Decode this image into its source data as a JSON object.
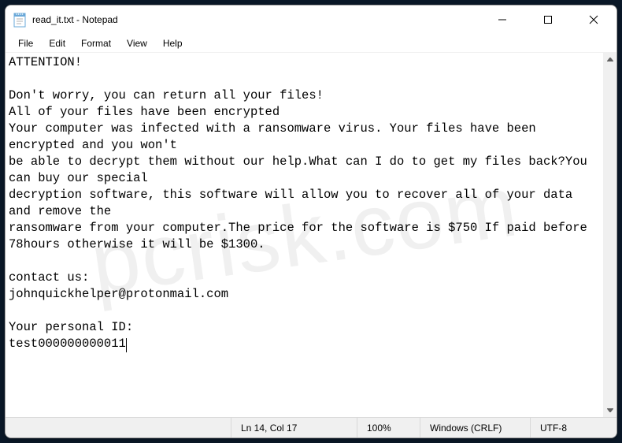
{
  "titlebar": {
    "title": "read_it.txt - Notepad"
  },
  "menubar": {
    "file": "File",
    "edit": "Edit",
    "format": "Format",
    "view": "View",
    "help": "Help"
  },
  "content": {
    "text": "ATTENTION!\n\nDon't worry, you can return all your files!\nAll of your files have been encrypted\nYour computer was infected with a ransomware virus. Your files have been encrypted and you won't\nbe able to decrypt them without our help.What can I do to get my files back?You can buy our special\ndecryption software, this software will allow you to recover all of your data and remove the\nransomware from your computer.The price for the software is $750 If paid before 78hours otherwise it will be $1300.\n\ncontact us:\njohnquickhelper@protonmail.com\n\nYour personal ID:\ntest000000000011"
  },
  "statusbar": {
    "position": "Ln 14, Col 17",
    "zoom": "100%",
    "lineending": "Windows (CRLF)",
    "encoding": "UTF-8"
  },
  "watermark": "pcrisk.com"
}
